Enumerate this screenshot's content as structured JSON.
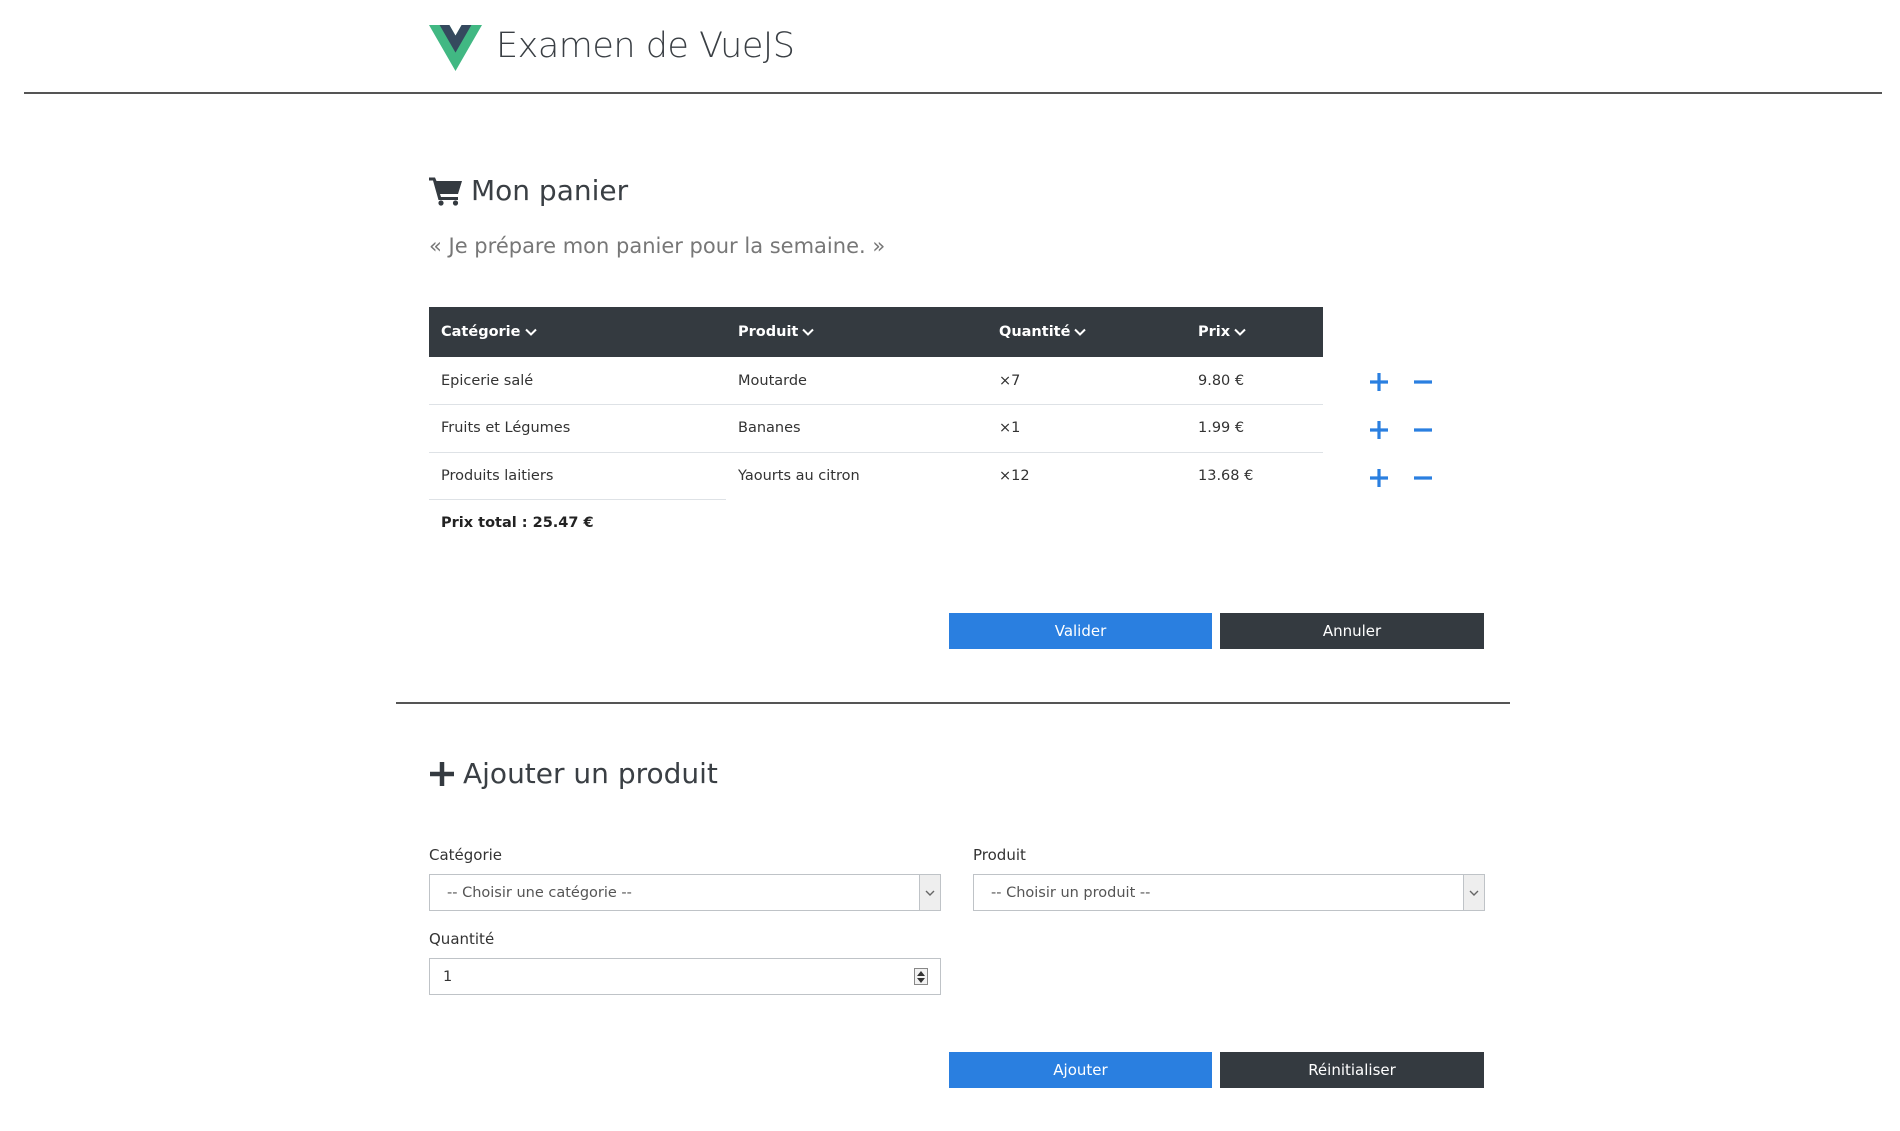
{
  "header": {
    "title": "Examen de VueJS"
  },
  "cart": {
    "title": "Mon panier",
    "quote": "« Je prépare mon panier pour la semaine. »",
    "columns": [
      "Catégorie",
      "Produit",
      "Quantité",
      "Prix"
    ],
    "rows": [
      {
        "category": "Epicerie salé",
        "product": "Moutarde",
        "quantity": "×7",
        "price": "9.80 €"
      },
      {
        "category": "Fruits et Légumes",
        "product": "Bananes",
        "quantity": "×1",
        "price": "1.99 €"
      },
      {
        "category": "Produits laitiers",
        "product": "Yaourts au citron",
        "quantity": "×12",
        "price": "13.68 €"
      }
    ],
    "total": "Prix total : 25.47 €",
    "validate_label": "Valider",
    "cancel_label": "Annuler"
  },
  "add_form": {
    "title": "Ajouter un produit",
    "category_label": "Catégorie",
    "category_value": "-- Choisir une catégorie --",
    "product_label": "Produit",
    "product_value": "-- Choisir un produit --",
    "quantity_label": "Quantité",
    "quantity_value": "1",
    "add_label": "Ajouter",
    "reset_label": "Réinitialiser"
  },
  "colors": {
    "primary": "#2a7fe0",
    "dark": "#343a40",
    "vue_green": "#41b883",
    "vue_dark": "#35495e"
  }
}
